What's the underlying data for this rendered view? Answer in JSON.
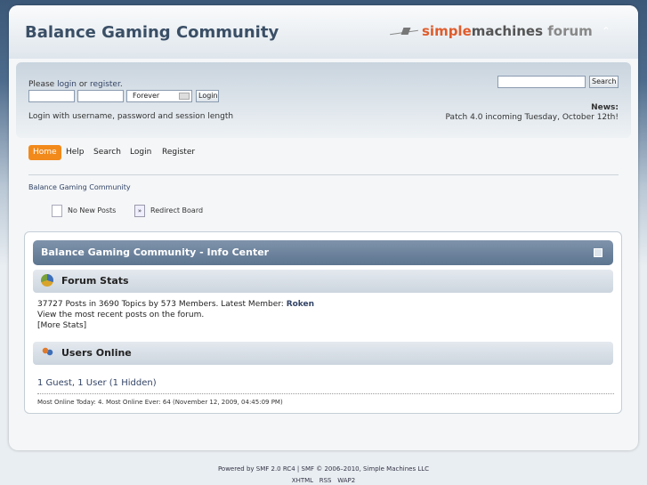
{
  "header": {
    "forum_title": "Balance Gaming Community",
    "logo_simple": "simple",
    "logo_machines": "machines",
    "logo_forum": "forum"
  },
  "user_area": {
    "prompt_prefix": "Please ",
    "login_link": "login",
    "or_text": " or ",
    "register_link": "register",
    "prompt_suffix": ".",
    "session_length": "Forever",
    "login_button": "Login",
    "sub_text": "Login with username, password and session length",
    "search_button": "Search",
    "news_label": "News:",
    "news_text": "Patch 4.0 incoming Tuesday, October 12th!"
  },
  "menu": {
    "items": [
      "Home",
      "Help",
      "Search",
      "Login",
      "Register"
    ]
  },
  "breadcrumb": "Balance Gaming Community",
  "legend": {
    "no_new_posts": "No New Posts",
    "redirect_board": "Redirect Board"
  },
  "info_center": {
    "title": "Balance Gaming Community - Info Center",
    "forum_stats_title": "Forum Stats",
    "stats_line": "37727 Posts in 3690 Topics by 573 Members. Latest Member: ",
    "latest_member": "Roken",
    "recent_posts_line": "View the most recent posts on the forum.",
    "more_stats": "[More Stats]",
    "users_online_title": "Users Online",
    "online_summary": "1 Guest, 1 User (1 Hidden)",
    "most_online": "Most Online Today: 4. Most Online Ever: 64 (November 12, 2009, 04:45:09 PM)"
  },
  "footer": {
    "line1": "Powered by SMF 2.0 RC4 | SMF © 2006–2010, Simple Machines LLC",
    "links": [
      "XHTML",
      "RSS",
      "WAP2"
    ]
  },
  "colors": {
    "accent": "#f28a1b",
    "header_bar": "#5d7590",
    "title": "#3a4f66"
  }
}
